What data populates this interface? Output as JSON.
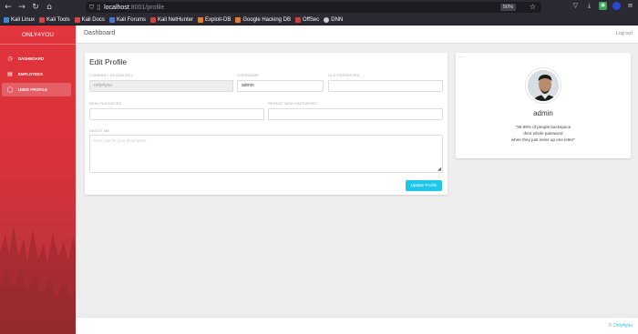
{
  "browser": {
    "url_host": "localhost",
    "url_path": ":8001/profile",
    "zoom": "50%",
    "bookmarks": [
      {
        "label": "Kali Linux",
        "color": "#3c8ad6"
      },
      {
        "label": "Kali Tools",
        "color": "#d84444"
      },
      {
        "label": "Kali Docs",
        "color": "#d84444"
      },
      {
        "label": "Kali Forums",
        "color": "#4a74d4"
      },
      {
        "label": "Kali NetHunter",
        "color": "#cf4242"
      },
      {
        "label": "Exploit-DB",
        "color": "#e97b2b"
      },
      {
        "label": "Google Hacking DB",
        "color": "#e97b2b"
      },
      {
        "label": "OffSec",
        "color": "#d83a3a"
      },
      {
        "label": "DNN",
        "color": "#cccccc"
      }
    ]
  },
  "sidebar": {
    "brand": "ONLY4YOU",
    "items": [
      {
        "label": "DASHBOARD",
        "icon": "clock-icon",
        "glyph": "◷"
      },
      {
        "label": "EMPLOYEES",
        "icon": "clipboard-icon",
        "glyph": "▤"
      },
      {
        "label": "USER PROFILE",
        "icon": "user-icon",
        "glyph": "◯"
      }
    ]
  },
  "topbar": {
    "title": "Dashboard",
    "logout": "Log out"
  },
  "edit_profile": {
    "title": "Edit Profile",
    "company_label": "COMPANY (DISABLED)",
    "company_value": "only4you",
    "username_label": "USERNAME",
    "username_value": "admin",
    "old_password_label": "OLD PASSWORD",
    "new_password_label": "NEW PASSWORD",
    "repeat_password_label": "REPEAT NEW PASSWORD",
    "about_label": "ABOUT ME",
    "about_placeholder": "Here can be your description",
    "submit": "Update Profile"
  },
  "user_card": {
    "dots": "...",
    "name": "admin",
    "quote_lines": [
      "\"99.99% of people backspace",
      "their whole password",
      "when they just mess up one letter\""
    ]
  },
  "footer": {
    "copyright": "©",
    "link": "Only4you"
  },
  "colors": {
    "accent": "#1dc7ea",
    "sidebar": "#e2353d"
  }
}
